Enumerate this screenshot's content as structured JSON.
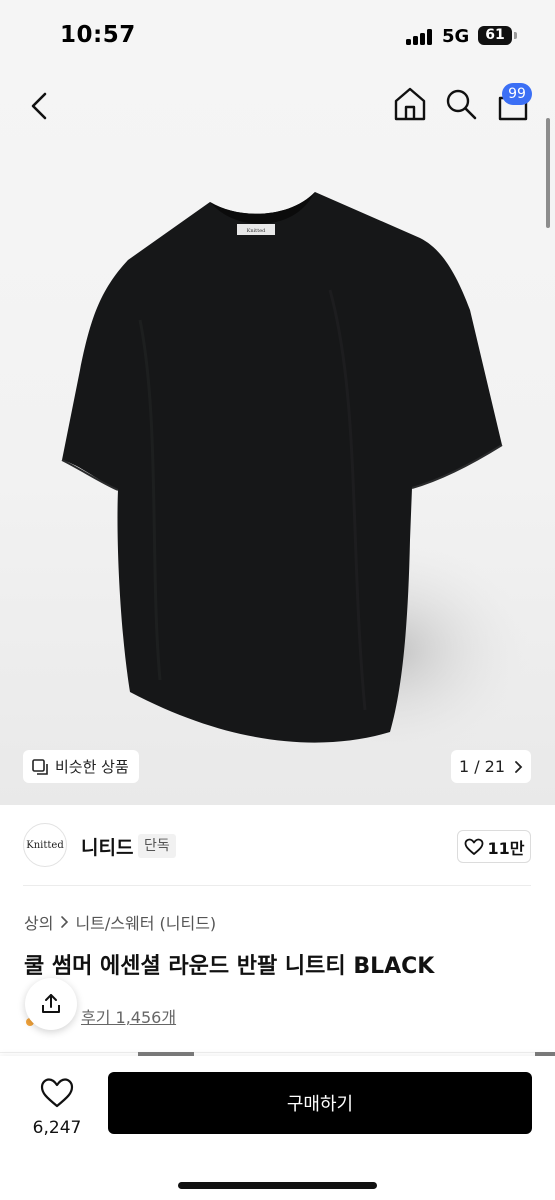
{
  "status_bar": {
    "time": "10:57",
    "network": "5G",
    "battery": "61"
  },
  "header": {
    "back_icon": "chevron-left-icon",
    "home_icon": "home-icon",
    "search_icon": "search-icon",
    "cart_icon": "cart-icon",
    "cart_badge": "99",
    "badge_color": "#3b6ff5"
  },
  "gallery": {
    "similar_label": "비슷한 상품",
    "page_indicator": "1 / 21",
    "shirt_label": "Knitted"
  },
  "brand": {
    "logo_text": "Knitted",
    "name": "니티드",
    "tag": "단독",
    "like_count": "11만"
  },
  "product": {
    "breadcrumb": [
      "상의",
      "니트/스웨터 (니티드)"
    ],
    "title": "쿨 썸머 에센셜 라운드 반팔 니트티 BLACK",
    "review_link": "후기 1,456개"
  },
  "bottom_bar": {
    "wish_count": "6,247",
    "buy_label": "구매하기"
  }
}
